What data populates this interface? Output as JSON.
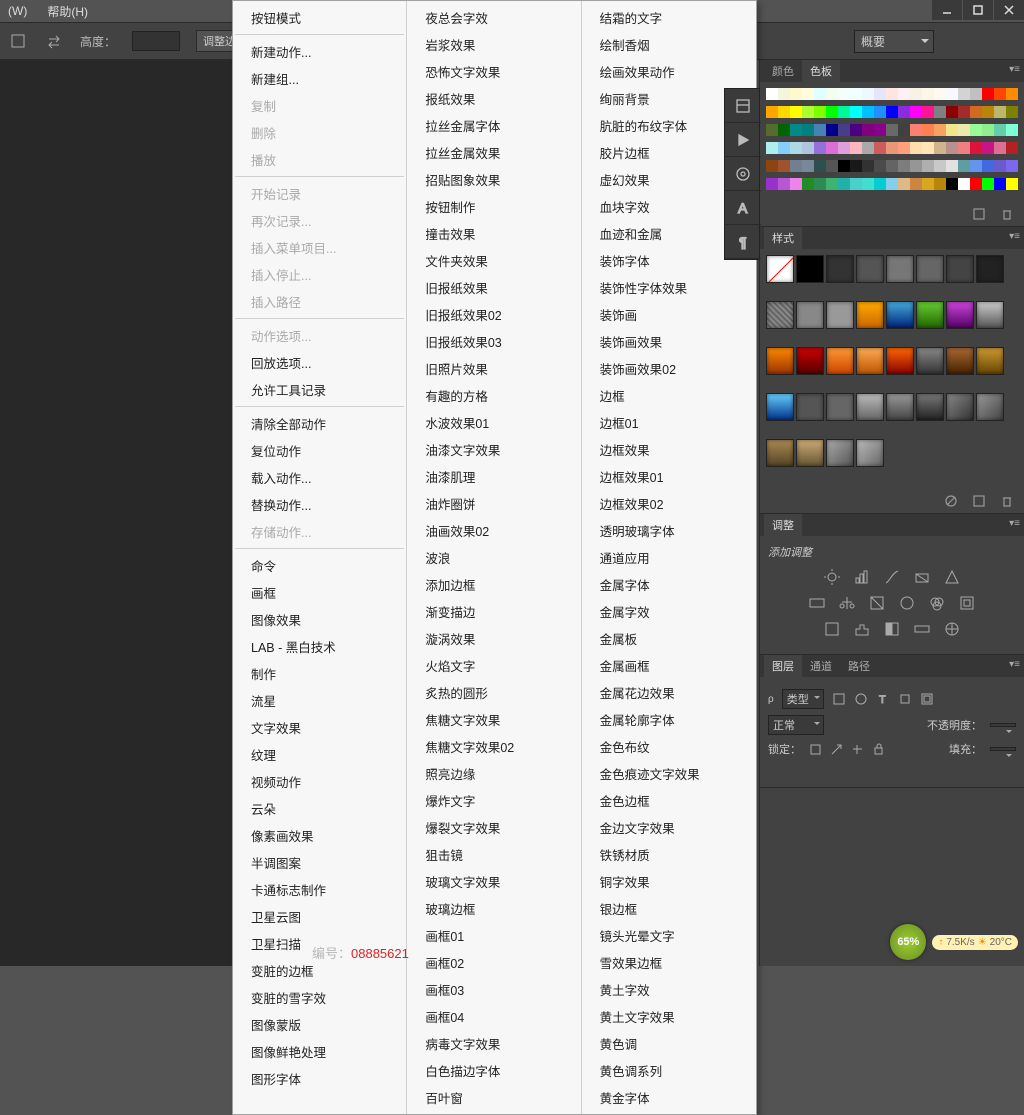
{
  "menubar": {
    "window": "(W)",
    "help": "帮助(H)"
  },
  "optionsbar": {
    "height_label": "高度：",
    "adjust_button": "调整边"
  },
  "workspace": {
    "selected": "概要"
  },
  "context_menu": {
    "col1": [
      {
        "t": "按钮模式"
      },
      {
        "sep": true
      },
      {
        "t": "新建动作..."
      },
      {
        "t": "新建组..."
      },
      {
        "t": "复制",
        "d": true
      },
      {
        "t": "删除",
        "d": true
      },
      {
        "t": "播放",
        "d": true
      },
      {
        "sep": true
      },
      {
        "t": "开始记录",
        "d": true
      },
      {
        "t": "再次记录...",
        "d": true
      },
      {
        "t": "插入菜单项目...",
        "d": true
      },
      {
        "t": "插入停止...",
        "d": true
      },
      {
        "t": "插入路径",
        "d": true
      },
      {
        "sep": true
      },
      {
        "t": "动作选项...",
        "d": true
      },
      {
        "t": "回放选项..."
      },
      {
        "t": "允许工具记录"
      },
      {
        "sep": true
      },
      {
        "t": "清除全部动作"
      },
      {
        "t": "复位动作"
      },
      {
        "t": "载入动作..."
      },
      {
        "t": "替换动作..."
      },
      {
        "t": "存储动作...",
        "d": true
      },
      {
        "sep": true
      },
      {
        "t": "命令"
      },
      {
        "t": "画框"
      },
      {
        "t": "图像效果"
      },
      {
        "t": "LAB - 黑白技术"
      },
      {
        "t": "制作"
      },
      {
        "t": "流星"
      },
      {
        "t": "文字效果"
      },
      {
        "t": "纹理"
      },
      {
        "t": "视频动作"
      },
      {
        "t": "云朵"
      },
      {
        "t": "像素画效果"
      },
      {
        "t": "半调图案"
      },
      {
        "t": "卡通标志制作"
      },
      {
        "t": "卫星云图"
      },
      {
        "t": "卫星扫描"
      },
      {
        "t": "变脏的边框"
      },
      {
        "t": "变脏的雪字效"
      },
      {
        "t": "图像蒙版"
      },
      {
        "t": "图像鲜艳处理"
      },
      {
        "t": "图形字体"
      }
    ],
    "col2": [
      {
        "t": "夜总会字效"
      },
      {
        "t": "岩浆效果"
      },
      {
        "t": "恐怖文字效果"
      },
      {
        "t": "报纸效果"
      },
      {
        "t": "拉丝金属字体"
      },
      {
        "t": "拉丝金属效果"
      },
      {
        "t": "招贴图象效果"
      },
      {
        "t": "按钮制作"
      },
      {
        "t": "撞击效果"
      },
      {
        "t": "文件夹效果"
      },
      {
        "t": "旧报纸效果"
      },
      {
        "t": "旧报纸效果02"
      },
      {
        "t": "旧报纸效果03"
      },
      {
        "t": "旧照片效果"
      },
      {
        "t": "有趣的方格"
      },
      {
        "t": "水波效果01"
      },
      {
        "t": "油漆文字效果"
      },
      {
        "t": "油漆肌理"
      },
      {
        "t": "油炸圈饼"
      },
      {
        "t": "油画效果02"
      },
      {
        "t": "波浪"
      },
      {
        "t": "添加边框"
      },
      {
        "t": "渐变描边"
      },
      {
        "t": "漩涡效果"
      },
      {
        "t": "火焰文字"
      },
      {
        "t": "炙热的圆形"
      },
      {
        "t": "焦糖文字效果"
      },
      {
        "t": "焦糖文字效果02"
      },
      {
        "t": "照亮边缘"
      },
      {
        "t": "爆炸文字"
      },
      {
        "t": "爆裂文字效果"
      },
      {
        "t": "狙击镜"
      },
      {
        "t": "玻璃文字效果"
      },
      {
        "t": "玻璃边框"
      },
      {
        "t": "画框01"
      },
      {
        "t": "画框02"
      },
      {
        "t": "画框03"
      },
      {
        "t": "画框04"
      },
      {
        "t": "病毒文字效果"
      },
      {
        "t": "白色描边字体"
      },
      {
        "t": "百叶窗"
      }
    ],
    "col3": [
      {
        "t": "结霜的文字"
      },
      {
        "t": "绘制香烟"
      },
      {
        "t": "绘画效果动作"
      },
      {
        "t": "绚丽背景"
      },
      {
        "t": "肮脏的布纹字体"
      },
      {
        "t": "胶片边框"
      },
      {
        "t": "虚幻效果"
      },
      {
        "t": "血块字效"
      },
      {
        "t": "血迹和金属"
      },
      {
        "t": "装饰字体"
      },
      {
        "t": "装饰性字体效果"
      },
      {
        "t": "装饰画"
      },
      {
        "t": "装饰画效果"
      },
      {
        "t": "装饰画效果02"
      },
      {
        "t": "边框"
      },
      {
        "t": "边框01"
      },
      {
        "t": "边框效果"
      },
      {
        "t": "边框效果01"
      },
      {
        "t": "边框效果02"
      },
      {
        "t": "透明玻璃字体"
      },
      {
        "t": "通道应用"
      },
      {
        "t": "金属字体"
      },
      {
        "t": "金属字效"
      },
      {
        "t": "金属板"
      },
      {
        "t": "金属画框"
      },
      {
        "t": "金属花边效果"
      },
      {
        "t": "金属轮廓字体"
      },
      {
        "t": "金色布纹"
      },
      {
        "t": "金色痕迹文字效果"
      },
      {
        "t": "金色边框"
      },
      {
        "t": "金边文字效果"
      },
      {
        "t": "铁锈材质"
      },
      {
        "t": "铜字效果"
      },
      {
        "t": "银边框"
      },
      {
        "t": "镜头光晕文字"
      },
      {
        "t": "雪效果边框"
      },
      {
        "t": "黄土字效"
      },
      {
        "t": "黄土文字效果"
      },
      {
        "t": "黄色调"
      },
      {
        "t": "黄色调系列"
      },
      {
        "t": "黄金字体"
      }
    ]
  },
  "panels": {
    "color_tab": "颜色",
    "swatches_tab": "色板",
    "styles_tab": "样式",
    "adjust_tab": "调整",
    "adjust_label": "添加调整",
    "layers_tab": "图层",
    "channels_tab": "通道",
    "paths_tab": "路径",
    "layer_kind": "类型",
    "layer_normal": "正常",
    "layer_opacity_label": "不透明度：",
    "layer_lock_label": "锁定：",
    "layer_fill_label": "填充："
  },
  "swatch_colors": [
    "#ffffff",
    "#f5f5dc",
    "#fffacd",
    "#ffffe0",
    "#e0ffff",
    "#f0fff0",
    "#f5fffa",
    "#f0ffff",
    "#f0f8ff",
    "#e6e6fa",
    "#ffe4e1",
    "#fff0f5",
    "#faf0e6",
    "#fdf5e6",
    "#fffaf0",
    "#f8f8ff",
    "#d3d3d3",
    "#c0c0c0",
    "#ff0000",
    "#ff4500",
    "#ff8c00",
    "#ffa500",
    "#ffd700",
    "#ffff00",
    "#adff2f",
    "#7fff00",
    "#00ff00",
    "#00fa9a",
    "#00ffff",
    "#00bfff",
    "#1e90ff",
    "#0000ff",
    "#8a2be2",
    "#ff00ff",
    "#ff1493",
    "#808080",
    "#8b0000",
    "#a52a2a",
    "#d2691e",
    "#b8860b",
    "#bdb76b",
    "#808000",
    "#556b2f",
    "#006400",
    "#008b8b",
    "#008080",
    "#4682b4",
    "#00008b",
    "#483d8b",
    "#4b0082",
    "#800080",
    "#8b008b",
    "#696969",
    "#404040",
    "#fa8072",
    "#ff7f50",
    "#f4a460",
    "#f0e68c",
    "#eee8aa",
    "#98fb98",
    "#90ee90",
    "#66cdaa",
    "#7fffd4",
    "#afeeee",
    "#87cefa",
    "#add8e6",
    "#b0c4de",
    "#9370db",
    "#da70d6",
    "#dda0dd",
    "#ffb6c1",
    "#a9a9a9",
    "#cd5c5c",
    "#e9967a",
    "#ffa07a",
    "#ffdead",
    "#ffe4b5",
    "#d2b48c",
    "#bc8f8f",
    "#f08080",
    "#dc143c",
    "#c71585",
    "#db7093",
    "#b22222",
    "#8b4513",
    "#a0522d",
    "#708090",
    "#778899",
    "#2f4f4f",
    "#555555",
    "#000000",
    "#191919",
    "#323232",
    "#4b4b4b",
    "#646464",
    "#7d7d7d",
    "#969696",
    "#afafaf",
    "#c8c8c8",
    "#e1e1e1",
    "#5f9ea0",
    "#6495ed",
    "#4169e1",
    "#6a5acd",
    "#7b68ee",
    "#9932cc",
    "#ba55d3",
    "#ee82ee",
    "#228b22",
    "#2e8b57",
    "#3cb371",
    "#20b2aa",
    "#48d1cc",
    "#40e0d0",
    "#00ced1",
    "#87ceeb",
    "#deb887",
    "#cd853f",
    "#daa520",
    "#b8860b",
    "#000000",
    "#ffffff",
    "#ff0000",
    "#00ff00",
    "#0000ff",
    "#ffff00"
  ],
  "style_swatches": [
    "linear-gradient(135deg,#fff,#fff)",
    "#000",
    "#333",
    "#555",
    "#777",
    "#666",
    "#444",
    "#222",
    "repeating-linear-gradient(45deg,#888,#888 2px,#666 2px,#666 4px)",
    "#888",
    "#999",
    "linear-gradient(#ffaa00,#cc6600)",
    "linear-gradient(#4ad,#027)",
    "linear-gradient(#6c3,#260)",
    "linear-gradient(#c4d,#506)",
    "linear-gradient(#ccc,#555)",
    "linear-gradient(#f80,#930)",
    "linear-gradient(#c00,#500)",
    "linear-gradient(#f93,#c40)",
    "linear-gradient(#fa5,#b50)",
    "linear-gradient(#f60,#800)",
    "linear-gradient(#888,#333)",
    "linear-gradient(#a63,#420)",
    "linear-gradient(#c93,#640)",
    "linear-gradient(#6cf,#038)",
    "#555",
    "",
    "linear-gradient(#bbb,#666)",
    "linear-gradient(#999,#444)",
    "linear-gradient(#777,#222)",
    "linear-gradient(135deg,#888,#333)",
    "linear-gradient(135deg,#999,#444)",
    "linear-gradient(#a85,#542)",
    "linear-gradient(#ca7,#653)",
    "linear-gradient(135deg,#aaa,#555)",
    "linear-gradient(135deg,#bbb,#666)"
  ],
  "net_badge": {
    "speed": "7.5K/s",
    "temp": "20°C"
  },
  "pct_badge_value": "65%",
  "watermark": {
    "label": "编号：",
    "id": "08885621"
  }
}
